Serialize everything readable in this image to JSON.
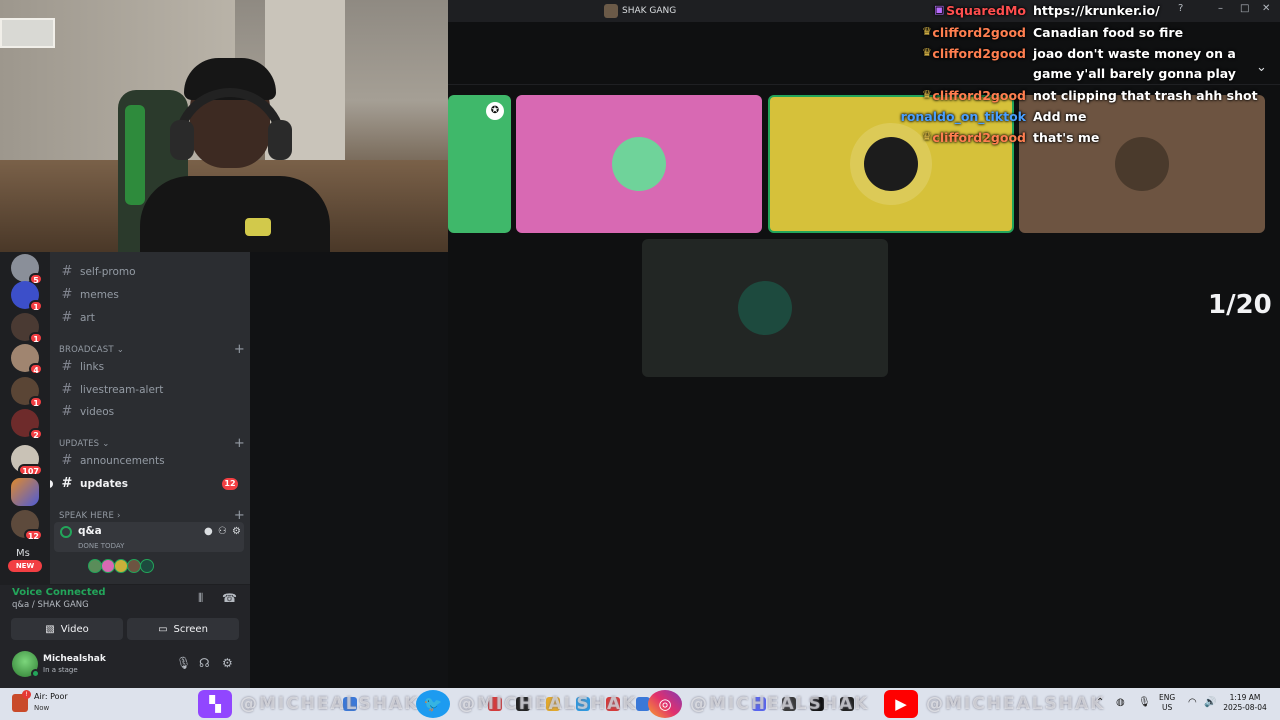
{
  "window": {
    "server_title": "SHAK GANG"
  },
  "guilds": [
    {
      "top": 0,
      "color": "#8a8f99",
      "badge": "5"
    },
    {
      "top": 0,
      "color": "#3c4fc9",
      "badge": "1"
    },
    {
      "top": 0,
      "color": "#4a3a33",
      "badge": "1"
    },
    {
      "top": 0,
      "color": "#a08570",
      "badge": "4"
    },
    {
      "top": 0,
      "color": "#5a4535",
      "badge": "1"
    },
    {
      "top": 0,
      "color": "#6e2b2b",
      "badge": "2"
    },
    {
      "top": 0,
      "color": "#c9c2b6",
      "badge": "107"
    },
    {
      "top": 0,
      "color": "#e08a2c",
      "badge": ""
    },
    {
      "top": 0,
      "color": "#5d4a3c",
      "badge": "12"
    }
  ],
  "guild_extra": {
    "ms_label": "Ms",
    "new_label": "NEW"
  },
  "channels": {
    "items_top": [
      {
        "name": "self-promo"
      },
      {
        "name": "memes"
      },
      {
        "name": "art"
      }
    ],
    "broadcast": {
      "title": "BROADCAST",
      "items": [
        {
          "name": "links"
        },
        {
          "name": "livestream-alert"
        },
        {
          "name": "videos"
        }
      ]
    },
    "updates": {
      "title": "UPDATES",
      "items": [
        {
          "name": "announcements"
        },
        {
          "name": "updates",
          "badge": "12"
        }
      ]
    },
    "speak": {
      "title": "SPEAK HERE",
      "stage_name": "q&a",
      "stage_sub": "DONE TODAY"
    }
  },
  "voice": {
    "status": "Voice Connected",
    "location": "q&a / SHAK GANG",
    "video_label": "Video",
    "screen_label": "Screen"
  },
  "user": {
    "name": "Michealshak",
    "status": "In a stage"
  },
  "tiles": [
    {
      "color": "#3fb86a",
      "avatar": "#3fb86a"
    },
    {
      "color": "#d869b3",
      "avatar": "#6fd39a"
    },
    {
      "color": "#d6c13a",
      "avatar": "#1c1c1c"
    },
    {
      "color": "#6d5441",
      "avatar": "#4a3a2c"
    },
    {
      "color": "#222624",
      "avatar": "#1d4a3e"
    }
  ],
  "counter": "1/20",
  "chat": [
    {
      "name": "SquaredMo",
      "color": "#ff4f4f",
      "badge": "▣",
      "msg": "https://krunker.io/"
    },
    {
      "name": "clifford2good",
      "color": "#ff7f50",
      "badge": "♛",
      "msg": "Canadian food so fire"
    },
    {
      "name": "clifford2good",
      "color": "#ff7f50",
      "badge": "♛",
      "msg": "joao don't waste money on a game y'all barely gonna play"
    },
    {
      "name": "clifford2good",
      "color": "#ff7f50",
      "badge": "♛",
      "msg": "not clipping that trash ahh shot"
    },
    {
      "name": "ronaldo_on_tiktok",
      "color": "#4a9fff",
      "badge": "",
      "msg": "Add me"
    },
    {
      "name": "clifford2good",
      "color": "#ff7f50",
      "badge": "♛",
      "msg": "that's me"
    }
  ],
  "taskbar": {
    "weather_title": "Air: Poor",
    "weather_sub": "Now",
    "social_handle": "@MICHEALSHAK",
    "lang_top": "ENG",
    "lang_bottom": "US",
    "time": "1:19 AM",
    "date": "2025-08-04"
  }
}
